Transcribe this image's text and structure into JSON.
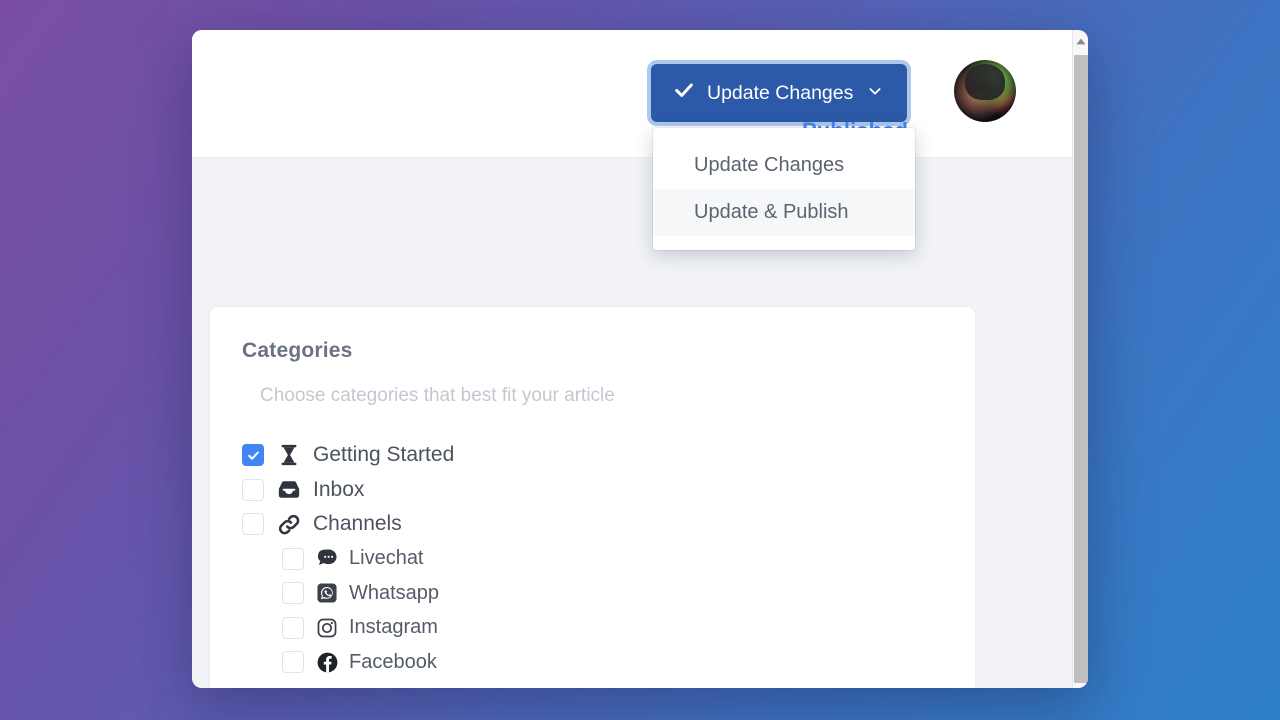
{
  "theme": {
    "gradient_from": "#7A4FA3",
    "gradient_to": "#2E81C8",
    "primary_blue": "#2C5AA8",
    "accent_blue": "#4285F4",
    "card_bg": "#FFFFFF",
    "content_bg": "#F1F3F7"
  },
  "header": {
    "primary_button": {
      "label": "Update Changes",
      "check_icon": "check-icon",
      "caret_icon": "chevron-down-icon"
    },
    "dropdown": {
      "items": [
        {
          "label": "Update Changes",
          "hovered": false
        },
        {
          "label": "Update & Publish",
          "hovered": true
        }
      ]
    },
    "status_text": "Published",
    "avatar_alt": "user-avatar"
  },
  "categories_card": {
    "title": "Categories",
    "subtitle": "Choose categories that best fit your article",
    "items": [
      {
        "label": "Getting Started",
        "icon": "hourglass-icon",
        "checked": true,
        "indent": false
      },
      {
        "label": "Inbox",
        "icon": "inbox-icon",
        "checked": false,
        "indent": false
      },
      {
        "label": "Channels",
        "icon": "link-icon",
        "checked": false,
        "indent": false
      },
      {
        "label": "Livechat",
        "icon": "livechat-icon",
        "checked": false,
        "indent": true
      },
      {
        "label": "Whatsapp",
        "icon": "whatsapp-icon",
        "checked": false,
        "indent": true
      },
      {
        "label": "Instagram",
        "icon": "instagram-icon",
        "checked": false,
        "indent": true
      },
      {
        "label": "Facebook",
        "icon": "facebook-icon",
        "checked": false,
        "indent": true
      }
    ]
  },
  "scrollbar": {
    "up_arrow_icon": "triangle-up-icon",
    "thumb_label": "vertical-scroll-thumb"
  }
}
